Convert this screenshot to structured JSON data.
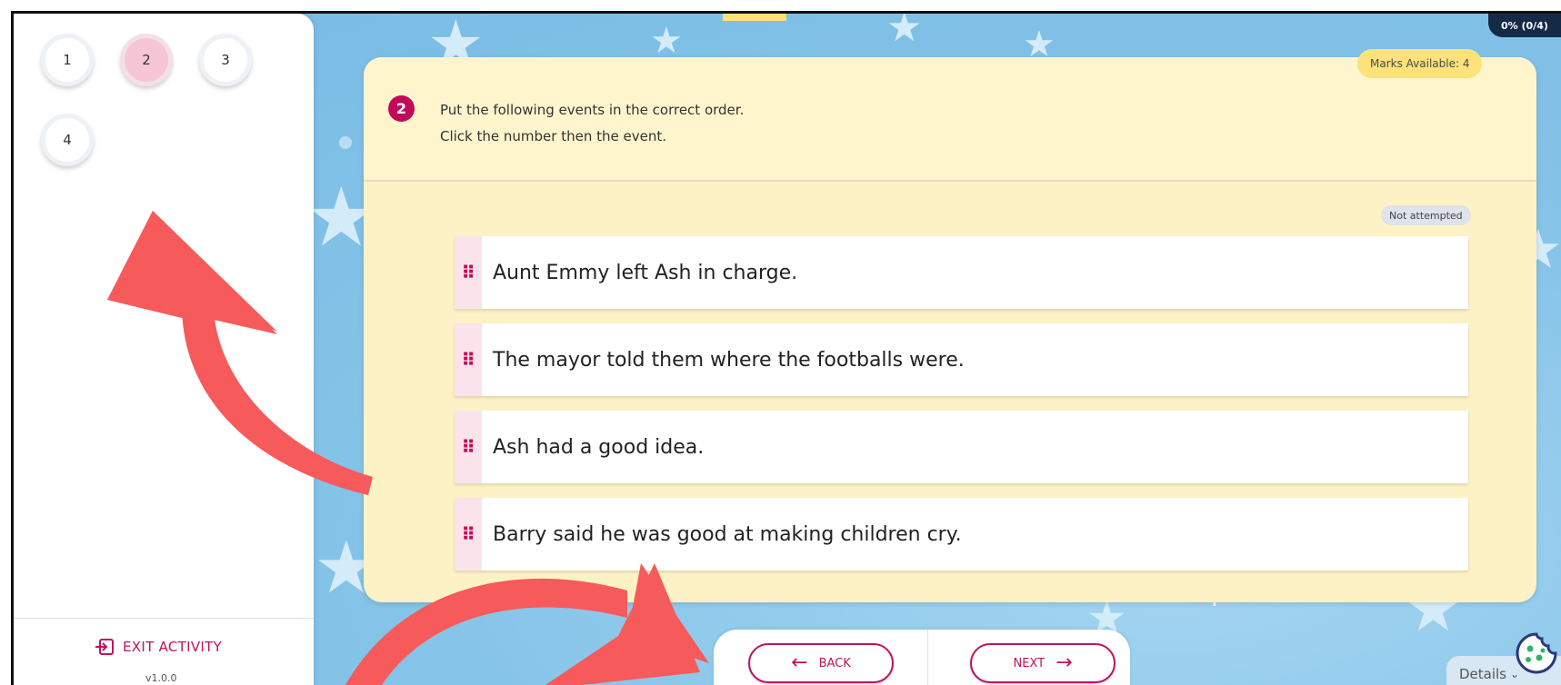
{
  "sidebar": {
    "questions": [
      {
        "label": "1",
        "active": false
      },
      {
        "label": "2",
        "active": true
      },
      {
        "label": "3",
        "active": false
      },
      {
        "label": "4",
        "active": false
      }
    ],
    "exit_label": "EXIT ACTIVITY",
    "version": "v1.0.0"
  },
  "progress": {
    "label": "0% (0/4)",
    "percent": 0
  },
  "question": {
    "number": "2",
    "marks_label": "Marks Available: 4",
    "line1": "Put the following events in the correct order.",
    "line2": "Click the number then the event.",
    "status": "Not attempted",
    "events": [
      "Aunt Emmy left Ash in charge.",
      "The mayor told them where the footballs were.",
      "Ash had a good idea.",
      "Barry said he was good at making children cry."
    ]
  },
  "nav": {
    "back_label": "BACK",
    "next_label": "NEXT"
  },
  "details_label": "Details",
  "icons": {
    "exit": "exit-icon",
    "drag": "drag-handle-icon",
    "back": "arrow-left-icon",
    "next": "arrow-right-icon",
    "cookie": "cookie-icon",
    "chevron": "chevron-down-icon"
  },
  "colors": {
    "accent": "#c0135b",
    "sky": "#7ec0e6",
    "card": "#fdf2c5",
    "annotation_arrow": "#f65a5a"
  }
}
